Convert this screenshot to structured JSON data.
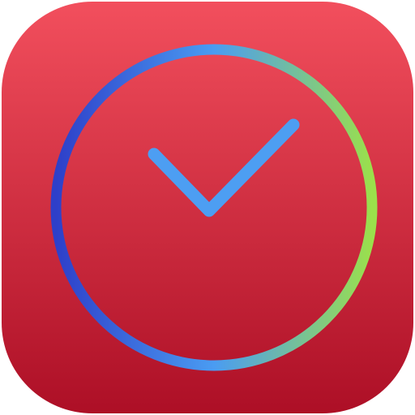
{
  "icon": {
    "semantic": "clock-check-icon",
    "colors": {
      "background_top": "#f24f5d",
      "background_bottom": "#ad0f26",
      "ring_left": "#2e3fc9",
      "ring_middle": "#4a9cf2",
      "ring_right": "#9be04b",
      "check_mark": "#4d9ef2"
    }
  }
}
